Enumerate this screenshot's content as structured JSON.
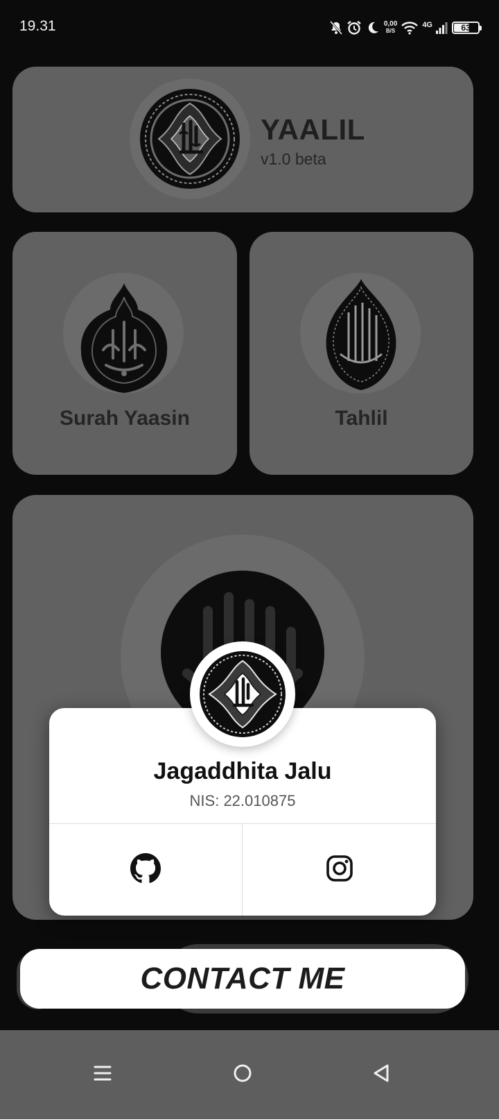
{
  "status_bar": {
    "time": "19.31",
    "net_speed_value": "0,00",
    "net_speed_unit": "B/S",
    "network_type": "4G",
    "battery_percent": "63"
  },
  "header": {
    "title": "YAALIL",
    "version": "v1.0 beta"
  },
  "menu": {
    "yaasin_label": "Surah Yaasin",
    "tahlil_label": "Tahlil"
  },
  "profile_dialog": {
    "name": "Jagaddhita Jalu",
    "nis": "NIS: 22.010875",
    "links": [
      {
        "icon": "github-icon"
      },
      {
        "icon": "instagram-icon"
      }
    ]
  },
  "contact_button": {
    "label": "CONTACT ME"
  },
  "nav_bar": {
    "buttons": [
      "menu-icon",
      "home-icon",
      "back-icon"
    ]
  },
  "colors": {
    "background": "#0b0b0b",
    "card": "#616161",
    "dialog": "#ffffff",
    "navbar": "#5e5e5e"
  }
}
